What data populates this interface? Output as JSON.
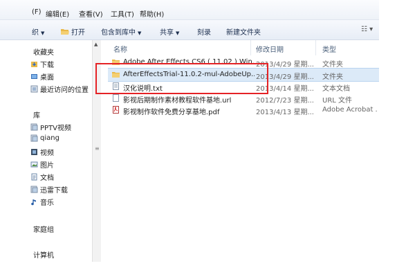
{
  "menubar": {
    "items": [
      "(F)",
      "编辑(E)",
      "查看(V)",
      "工具(T)",
      "帮助(H)"
    ]
  },
  "toolbar": {
    "organize": "织",
    "open": "打开",
    "include_in_library": "包含到库中",
    "share": "共享",
    "burn": "刻录",
    "new_folder": "新建文件夹"
  },
  "sidebar": {
    "favorites": "收藏夹",
    "downloads": "下载",
    "desktop": "桌面",
    "recent": "最近访问的位置",
    "libraries": "库",
    "pptv": "PPTV视频",
    "qiang": "qiang",
    "videos": "视频",
    "pictures": "图片",
    "documents": "文档",
    "xunlei": "迅雷下载",
    "music": "音乐",
    "homegroup": "家庭组",
    "computer": "计算机"
  },
  "columns": {
    "name": "名称",
    "modified": "修改日期",
    "type": "类型"
  },
  "files": [
    {
      "name": "Adobe After Effects CS6 ( 11.02 ) Win...",
      "date": "2013/4/29 星期...",
      "type": "文件夹",
      "icon": "folder-icon"
    },
    {
      "name": "AfterEffectsTrial-11.0.2-mul-AdobeUp...",
      "date": "2013/4/29 星期...",
      "type": "文件夹",
      "icon": "folder-icon"
    },
    {
      "name": "汉化说明.txt",
      "date": "2013/4/14 星期...",
      "type": "文本文档",
      "icon": "text-file-icon"
    },
    {
      "name": "影视后期制作素材教程软件基地.url",
      "date": "2012/7/23 星期...",
      "type": "URL 文件",
      "icon": "url-file-icon"
    },
    {
      "name": "影视制作软件免费分享基地.pdf",
      "date": "2013/4/13 星期...",
      "type": "Adobe Acrobat ...",
      "icon": "pdf-file-icon"
    }
  ],
  "colors": {
    "highlight": "#e52225",
    "selection": "#dceaf8",
    "folder": "#e9b949"
  }
}
